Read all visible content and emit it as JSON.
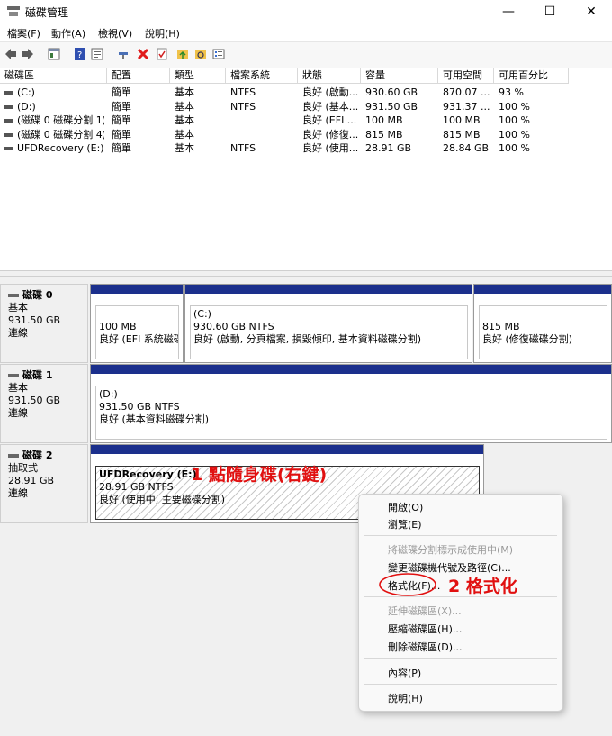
{
  "window": {
    "title": "磁碟管理",
    "minimize": "—",
    "maximize": "☐",
    "close": "✕"
  },
  "menu": [
    "檔案(F)",
    "動作(A)",
    "檢視(V)",
    "說明(H)"
  ],
  "toolbar": {
    "icons": [
      "back-icon",
      "forward-icon",
      "console-tree-icon",
      "help-icon",
      "properties-icon",
      "connect-icon",
      "delete-icon",
      "check-icon",
      "folder-up-icon",
      "folder-search-icon",
      "list-view-icon"
    ]
  },
  "table": {
    "columns": [
      "磁碟區",
      "配置",
      "類型",
      "檔案系統",
      "狀態",
      "容量",
      "可用空間",
      "可用百分比"
    ],
    "rows": [
      [
        "(C:)",
        "簡單",
        "基本",
        "NTFS",
        "良好 (啟動...",
        "930.60 GB",
        "870.07 ...",
        "93 %"
      ],
      [
        "(D:)",
        "簡單",
        "基本",
        "NTFS",
        "良好 (基本...",
        "931.50 GB",
        "931.37 ...",
        "100 %"
      ],
      [
        "(磁碟 0 磁碟分割 1)",
        "簡單",
        "基本",
        "",
        "良好 (EFI ...",
        "100 MB",
        "100 MB",
        "100 %"
      ],
      [
        "(磁碟 0 磁碟分割 4)",
        "簡單",
        "基本",
        "",
        "良好 (修復...",
        "815 MB",
        "815 MB",
        "100 %"
      ],
      [
        "UFDRecovery (E:)",
        "簡單",
        "基本",
        "NTFS",
        "良好 (使用...",
        "28.91 GB",
        "28.84 GB",
        "100 %"
      ]
    ]
  },
  "disks": [
    {
      "name": "磁碟 0",
      "type": "基本",
      "size": "931.50 GB",
      "status": "連線",
      "partitions": [
        {
          "label": "",
          "line1": "100 MB",
          "line2": "良好 (EFI 系統磁碟分"
        },
        {
          "label": "(C:)",
          "line1": "930.60 GB NTFS",
          "line2": "良好 (啟動, 分頁檔案, 損毀傾印, 基本資料磁碟分割)"
        },
        {
          "label": "",
          "line1": "815 MB",
          "line2": "良好 (修復磁碟分割)"
        }
      ]
    },
    {
      "name": "磁碟 1",
      "type": "基本",
      "size": "931.50 GB",
      "status": "連線",
      "partitions": [
        {
          "label": "(D:)",
          "line1": "931.50 GB NTFS",
          "line2": "良好 (基本資料磁碟分割)"
        }
      ]
    },
    {
      "name": "磁碟 2",
      "type": "抽取式",
      "size": "28.91 GB",
      "status": "連線",
      "partitions": [
        {
          "label": "UFDRecovery (E:)",
          "line1": "28.91 GB NTFS",
          "line2": "良好 (使用中, 主要磁碟分割)"
        }
      ]
    }
  ],
  "annotations": {
    "step1": "1 點隨身碟(右鍵)",
    "step2": "2 格式化",
    "color": "#e11010"
  },
  "context_menu": {
    "items": [
      {
        "label": "開啟(O)",
        "enabled": true
      },
      {
        "label": "瀏覽(E)",
        "enabled": true
      },
      {
        "label": "將磁碟分割標示成使用中(M)",
        "enabled": false
      },
      {
        "label": "變更磁碟機代號及路徑(C)...",
        "enabled": true
      },
      {
        "label": "格式化(F)...",
        "enabled": true,
        "highlighted": true
      },
      {
        "label": "延伸磁碟區(X)...",
        "enabled": false
      },
      {
        "label": "壓縮磁碟區(H)...",
        "enabled": true
      },
      {
        "label": "刪除磁碟區(D)...",
        "enabled": true
      },
      {
        "label": "內容(P)",
        "enabled": true
      },
      {
        "label": "說明(H)",
        "enabled": true
      }
    ]
  },
  "colors": {
    "partition_bar": "#1b2f8c",
    "highlight": "#e3e3e3"
  }
}
